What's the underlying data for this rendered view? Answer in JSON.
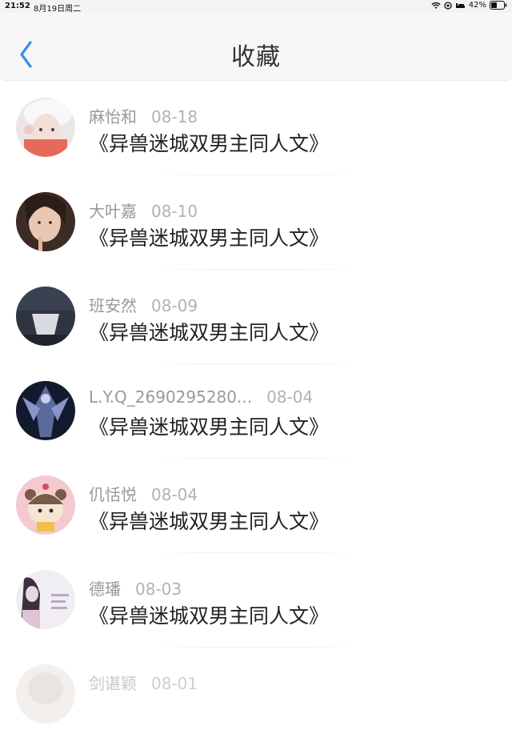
{
  "status_bar": {
    "time": "21:52",
    "date": "8月19日周二",
    "battery": "42%",
    "icons": [
      "wifi-icon",
      "location-icon",
      "sleep-icon",
      "battery-icon"
    ]
  },
  "header": {
    "back_icon": "chevron-left-icon",
    "title": "收藏"
  },
  "colors": {
    "accent": "#3b8ee8",
    "title_text": "#222222",
    "meta_text": "#999999"
  },
  "favorites": [
    {
      "author": "麻怡和",
      "date": "08-18",
      "title": "《异兽迷城双男主同人文》"
    },
    {
      "author": "大叶嘉",
      "date": "08-10",
      "title": "《异兽迷城双男主同人文》"
    },
    {
      "author": "班安然",
      "date": "08-09",
      "title": "《异兽迷城双男主同人文》"
    },
    {
      "author": "L.Y.Q_2690295280...",
      "date": "08-04",
      "title": "《异兽迷城双男主同人文》"
    },
    {
      "author": "仉恬悦",
      "date": "08-04",
      "title": "《异兽迷城双男主同人文》"
    },
    {
      "author": "德璠",
      "date": "08-03",
      "title": "《异兽迷城双男主同人文》"
    },
    {
      "author": "剑谌颖",
      "date": "08-01"
    }
  ]
}
